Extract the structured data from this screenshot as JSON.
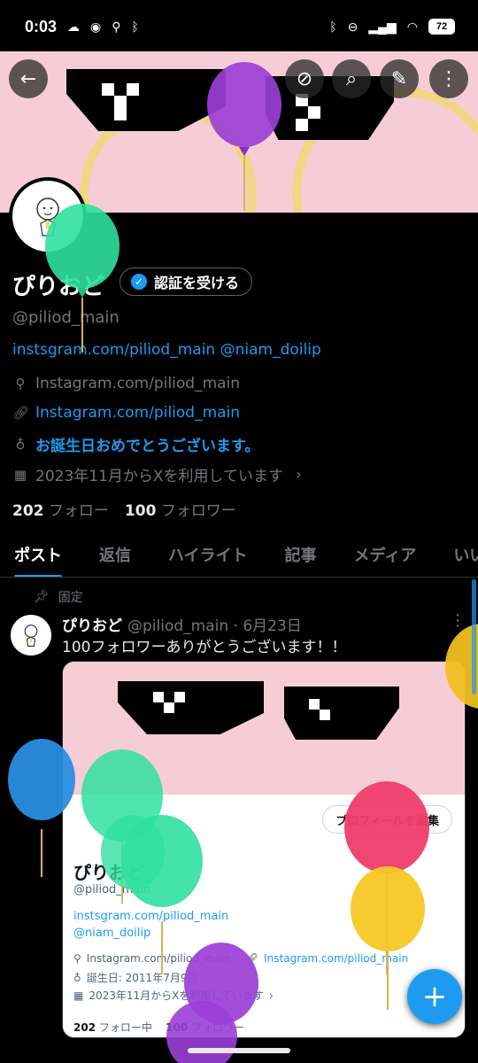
{
  "status_bar": {
    "time": "0:03",
    "battery": "72"
  },
  "profile": {
    "name": "ぴりおど",
    "verify_label": "認証を受ける",
    "handle": "@piliod_main",
    "bio": "instsgram.com/piliod_main @niam_doilip",
    "location": "Instagram.com/piliod_main",
    "website": "Instagram.com/piliod_main",
    "birthday": "お誕生日おめでとうございます。",
    "joined": "2023年11月からXを利用しています",
    "following_count": "202",
    "following_label": "フォロー",
    "followers_count": "100",
    "followers_label": "フォロワー"
  },
  "tabs": [
    "ポスト",
    "返信",
    "ハイライト",
    "記事",
    "メディア",
    "いい"
  ],
  "post": {
    "pinned_label": "固定",
    "author": "ぴりおど",
    "handle_date": "@piliod_main · 6月23日",
    "text": "100フォロワーありがとうございます！！",
    "media": {
      "edit_button": "プロフィールを編集",
      "name": "ぴりおど",
      "handle": "@piliod_main",
      "bio_line1": "instsgram.com/piliod_main",
      "bio_line2": "@niam_doilip",
      "location": "Instagram.com/piliod_main",
      "website": "Instagram.com/piliod_main",
      "birthday": "誕生日: 2011年7月9日",
      "joined": "2023年11月からXを利用しています",
      "following_count": "202",
      "following_label": "フォロー中",
      "followers_count": "100",
      "followers_label": "フォロワー"
    }
  },
  "colors": {
    "accent": "#1d9bf0",
    "banner": "#f6cdd6"
  },
  "icons": [
    "back-arrow-icon",
    "edit-off-icon",
    "search-icon",
    "pencil-icon",
    "more-vertical-icon",
    "location-icon",
    "link-icon",
    "balloon-icon",
    "calendar-icon",
    "pin-icon",
    "plus-icon"
  ]
}
